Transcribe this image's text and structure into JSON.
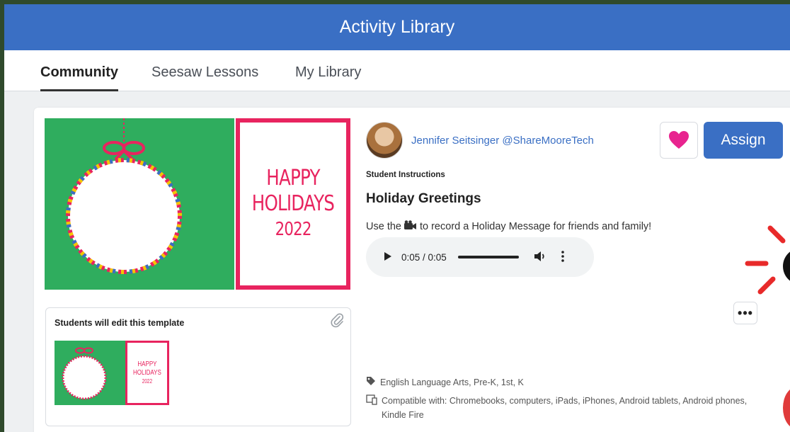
{
  "window": {
    "title": "Activity Library"
  },
  "tabs": [
    {
      "label": "Community",
      "active": true
    },
    {
      "label": "Seesaw Lessons",
      "active": false
    },
    {
      "label": "My Library",
      "active": false
    }
  ],
  "activity": {
    "author": "Jennifer Seitsinger @ShareMooreTech",
    "assign_label": "Assign",
    "instructions_label": "Student Instructions",
    "title": "Holiday Greetings",
    "instructions_before": "Use the",
    "instructions_after": "to record a Holiday Message for friends and family!",
    "audio_time": "0:05 / 0:05",
    "subjects": "English Language Arts, Pre-K, 1st, K",
    "compatible": "Compatible with: Chromebooks, computers, iPads, iPhones, Android tablets, Android phones, Kindle Fire"
  },
  "hero_image": {
    "line1": "HAPPY",
    "line2": "HOLIDAYS",
    "line3": "2022"
  },
  "template": {
    "title": "Students will edit this template",
    "thumb_line1": "HAPPY",
    "thumb_line2": "HOLIDAYS",
    "thumb_line3": "2022"
  },
  "colors": {
    "accent": "#3a6fc4",
    "heart": "#e8248f",
    "template_green": "#2fad5e",
    "template_pink": "#e8245f",
    "highlight_red": "#e82a2a"
  }
}
